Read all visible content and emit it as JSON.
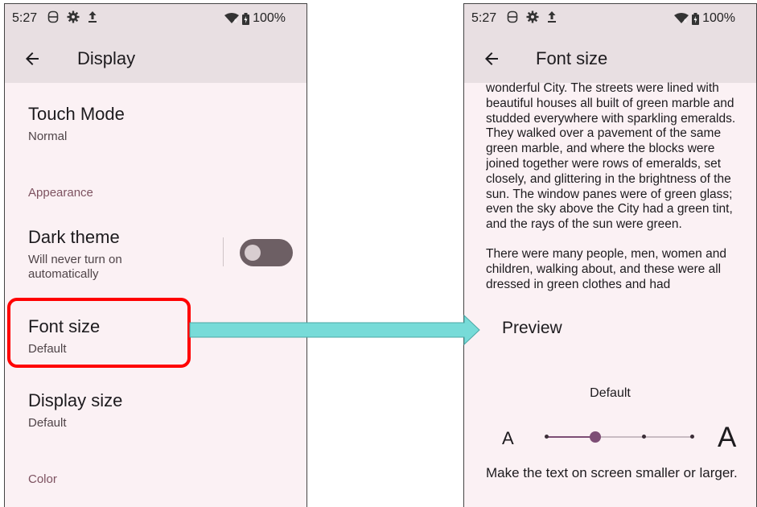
{
  "left": {
    "status": {
      "time": "5:27",
      "battery": "100%"
    },
    "title": "Display",
    "touch_mode": {
      "title": "Touch Mode",
      "summary": "Normal"
    },
    "appearance_header": "Appearance",
    "dark_theme": {
      "title": "Dark theme",
      "summary_line1": "Will never turn on",
      "summary_line2": "automatically",
      "enabled": false
    },
    "font_size": {
      "title": "Font size",
      "summary": "Default"
    },
    "display_size": {
      "title": "Display size",
      "summary": "Default"
    },
    "color_header": "Color"
  },
  "right": {
    "status": {
      "time": "5:27",
      "battery": "100%"
    },
    "title": "Font size",
    "preview_paragraph1": "wonderful City. The streets were lined with beautiful houses all built of green marble and studded everywhere with sparkling emeralds. They walked over a pavement of the same green marble, and where the blocks were joined together were rows of emeralds, set closely, and glittering in the brightness of the sun. The window panes were of green glass; even the sky above the City had a green tint, and the rays of the sun were green.",
    "preview_paragraph2": "There were many people, men, women and children, walking about, and these were all dressed in green clothes and had",
    "preview_label": "Preview",
    "current_value": "Default",
    "small_a": "A",
    "large_a": "A",
    "slider": {
      "steps": 4,
      "selected_index": 1
    },
    "description": "Make the text on screen smaller or larger."
  },
  "colors": {
    "highlight": "#ff0000",
    "arrow": "#77dbd8",
    "accent": "#7d4e75"
  }
}
